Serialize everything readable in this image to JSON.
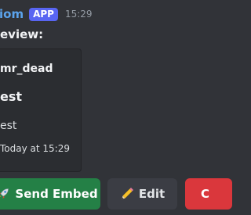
{
  "message": {
    "author": "iom",
    "badge": "APP",
    "timestamp": "15:29",
    "content": "eview:"
  },
  "embed": {
    "author": "mr_dead",
    "title": "est",
    "description": "est",
    "footer": "Today at 15:29"
  },
  "buttons": {
    "send_label": "Send Embed",
    "send_icon": "rocket-icon",
    "edit_label": "Edit",
    "edit_icon": "pencil-icon",
    "third_label_partial": "C"
  },
  "colors": {
    "background": "#313338",
    "author_name": "#5ba3ec",
    "badge": "#5865f2",
    "embed_bg": "#2b2d31",
    "send_button": "#248046",
    "edit_button": "#3b3d44",
    "third_button": "#da373c"
  }
}
